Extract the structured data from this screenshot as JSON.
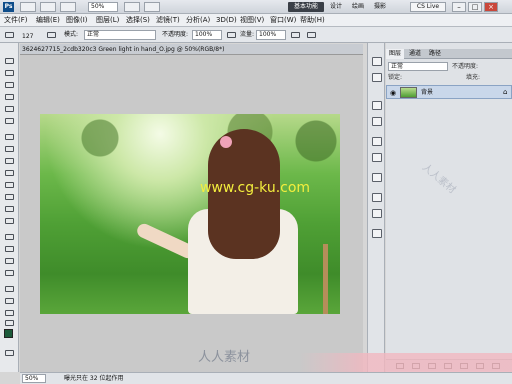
{
  "app": {
    "logo": "Ps"
  },
  "titlebar": {
    "zoom": "50%",
    "workspaces": [
      "基本功能",
      "设计",
      "绘画",
      "摄影"
    ],
    "cs_live": "CS Live",
    "window_buttons": [
      "–",
      "□",
      "×"
    ]
  },
  "menu": [
    "文件(F)",
    "编辑(E)",
    "图像(I)",
    "图层(L)",
    "选择(S)",
    "滤镜(T)",
    "分析(A)",
    "3D(D)",
    "视图(V)",
    "窗口(W)",
    "帮助(H)"
  ],
  "options": {
    "brush_size": "127",
    "mode_label": "模式:",
    "mode_value": "正常",
    "opacity_label": "不透明度:",
    "opacity_value": "100%",
    "flow_label": "流量:",
    "flow_value": "100%"
  },
  "document": {
    "title": "3624627715_2cdb320c3 Green light in hand_O.jpg @ 50%(RGB/8*)",
    "watermark": "www.cg-ku.com"
  },
  "status": {
    "zoom": "50%",
    "info": "曝光只在 32 位起作用"
  },
  "panel": {
    "tabs": [
      "图层",
      "通道",
      "路径"
    ],
    "blend_mode": "正常",
    "opacity_label": "不透明度:",
    "lock_label": "锁定:",
    "fill_label": "填充:",
    "layer_name": "背景"
  },
  "watermarks": {
    "center": "人人素材",
    "side": "人人素材"
  },
  "colors": {
    "foreground": "#1c5a3a",
    "background": "#ffffff",
    "active_workspace": "#3a3f47"
  }
}
